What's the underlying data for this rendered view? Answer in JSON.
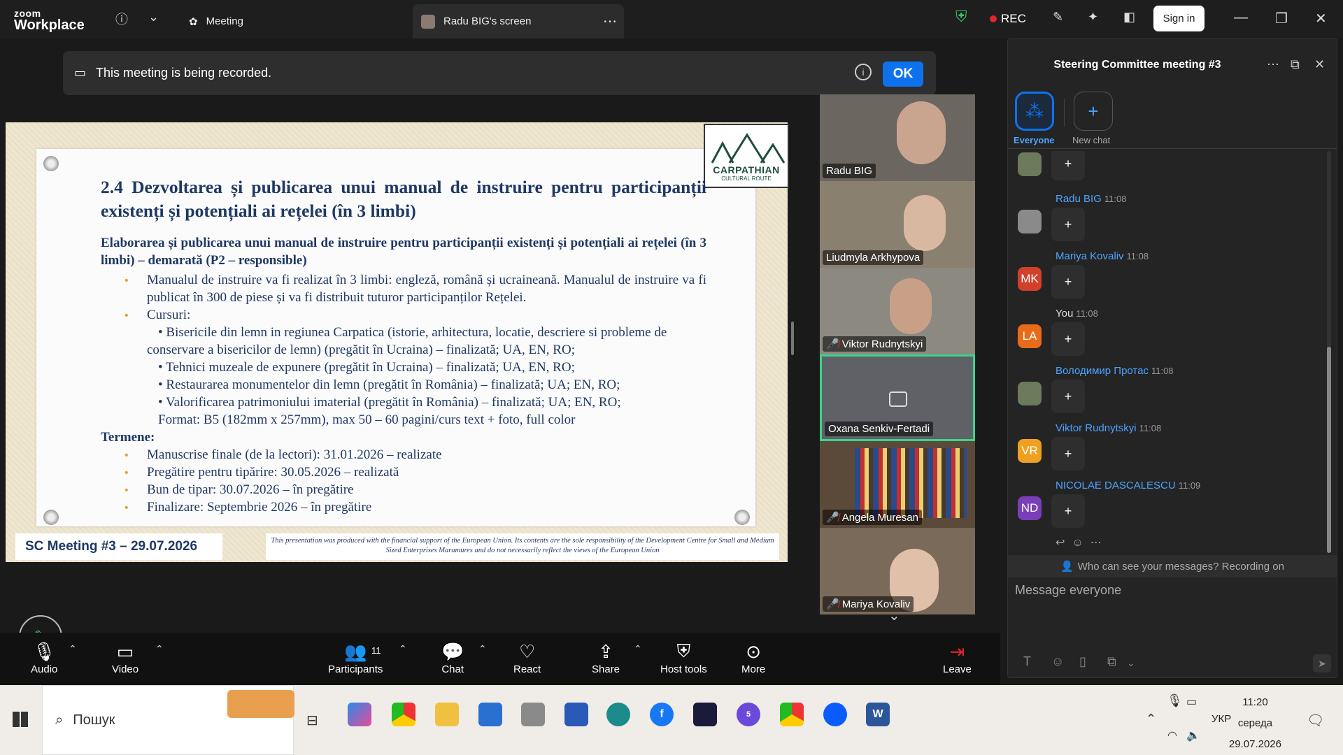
{
  "app": {
    "logo_line1": "zoom",
    "logo_line2": "Workplace"
  },
  "tabs": [
    {
      "label": "Meeting"
    },
    {
      "label": "Radu BIG's screen"
    }
  ],
  "status": {
    "rec": "REC",
    "sign_in": "Sign in"
  },
  "banner": {
    "text": "This meeting is being recorded.",
    "ok": "OK"
  },
  "slide": {
    "title": "2.4 Dezvoltarea și publicarea unui manual de instruire pentru participanții existenți și potențiali ai rețelei (în 3 limbi)",
    "subtitle": "Elaborarea și publicarea unui manual de instruire pentru participanții existenți și potențiali ai rețelei (în 3 limbi) – demarată (P2 – responsible)",
    "bullet1": "Manualul de instruire va fi realizat în 3 limbi: engleză, română și ucraineană. Manualul de instruire va fi publicat în 300 de piese și va fi distribuit tuturor participanților Rețelei.",
    "bullet2": "Cursuri:",
    "courses": [
      "• Bisericile din lemn in regiunea Carpatica (istorie, arhitectura, locatie, descriere si probleme de conservare a bisericilor de lemn) (pregătit în Ucraina) – finalizată; UA, EN, RO;",
      "• Tehnici muzeale de expunere (pregătit în Ucraina) – finalizată; UA, EN, RO;",
      "• Restaurarea monumentelor din lemn (pregătit în România) – finalizată; UA; EN, RO;",
      "• Valorificarea patrimoniului imaterial (pregătit în România) – finalizată; UA; EN, RO;",
      "Format: B5 (182mm x 257mm), max 50 – 60 pagini/curs text + foto, full color"
    ],
    "termene_label": "Termene:",
    "termene": [
      "Manuscrise finale (de la lectori): 31.01.2026 – realizate",
      "Pregătire pentru tipărire: 30.05.2026 – realizată",
      "Bun de tipar: 30.07.2026 – în pregătire",
      "Finalizare: Septembrie 2026 – în pregătire"
    ],
    "logo_title": "CARPATHIAN",
    "logo_sub": "CULTURAL ROUTE",
    "footer_left": "SC Meeting #3 – 29.07.2026",
    "footer_right": "This presentation was produced with the financial support of the European Union. Its contents are the sole responsibility of the Development Centre for Small and Medium Sized Enterprises Maramures and do not necessarily reflect the views of the European Union"
  },
  "gallery": [
    {
      "name": "Radu BIG",
      "muted": false,
      "color": "#6b6660"
    },
    {
      "name": "Liudmyla Arkhypova",
      "muted": false,
      "color": "#8a8070"
    },
    {
      "name": "Viktor Rudnytskyi",
      "muted": true,
      "color": "#8c8a80"
    },
    {
      "name": "Oxana Senkiv-Fertadi",
      "muted": false,
      "color": "#5f6166"
    },
    {
      "name": "Angela Muresan",
      "muted": true,
      "color": "#5b4a3a"
    },
    {
      "name": "Mariya Kovaliv",
      "muted": true,
      "color": "#7a6a5a"
    }
  ],
  "toolbar": {
    "audio": "Audio",
    "video": "Video",
    "participants": "Participants",
    "participants_count": "11",
    "chat": "Chat",
    "react": "React",
    "share": "Share",
    "host_tools": "Host tools",
    "more": "More",
    "leave": "Leave"
  },
  "chat": {
    "title": "Steering Committee meeting #3",
    "tab_everyone": "Everyone",
    "tab_new": "New chat",
    "messages": [
      {
        "name": "",
        "time": "",
        "initials": "",
        "color": "#6a7a5a"
      },
      {
        "name": "Radu BIG",
        "time": "11:08",
        "initials": "",
        "color": "#8a8a8a"
      },
      {
        "name": "Mariya Kovaliv",
        "time": "11:08",
        "initials": "MK",
        "color": "#d0402a"
      },
      {
        "name": "You",
        "time": "11:08",
        "initials": "LA",
        "color": "#e86b1a"
      },
      {
        "name": "Володимир Протас",
        "time": "11:08",
        "initials": "",
        "color": "#6a7a5a"
      },
      {
        "name": "Viktor Rudnytskyi",
        "time": "11:08",
        "initials": "VR",
        "color": "#f0a020"
      },
      {
        "name": "NICOLAE DASCALESCU",
        "time": "11:09",
        "initials": "ND",
        "color": "#7a3fb8"
      }
    ],
    "visibility": "Who can see your messages? Recording on",
    "placeholder": "Message everyone"
  },
  "taskbar": {
    "search": "Пошук",
    "lang": "УКР",
    "time": "11:20",
    "day": "середа",
    "date": "29.07.2026",
    "app_badge": "5"
  }
}
